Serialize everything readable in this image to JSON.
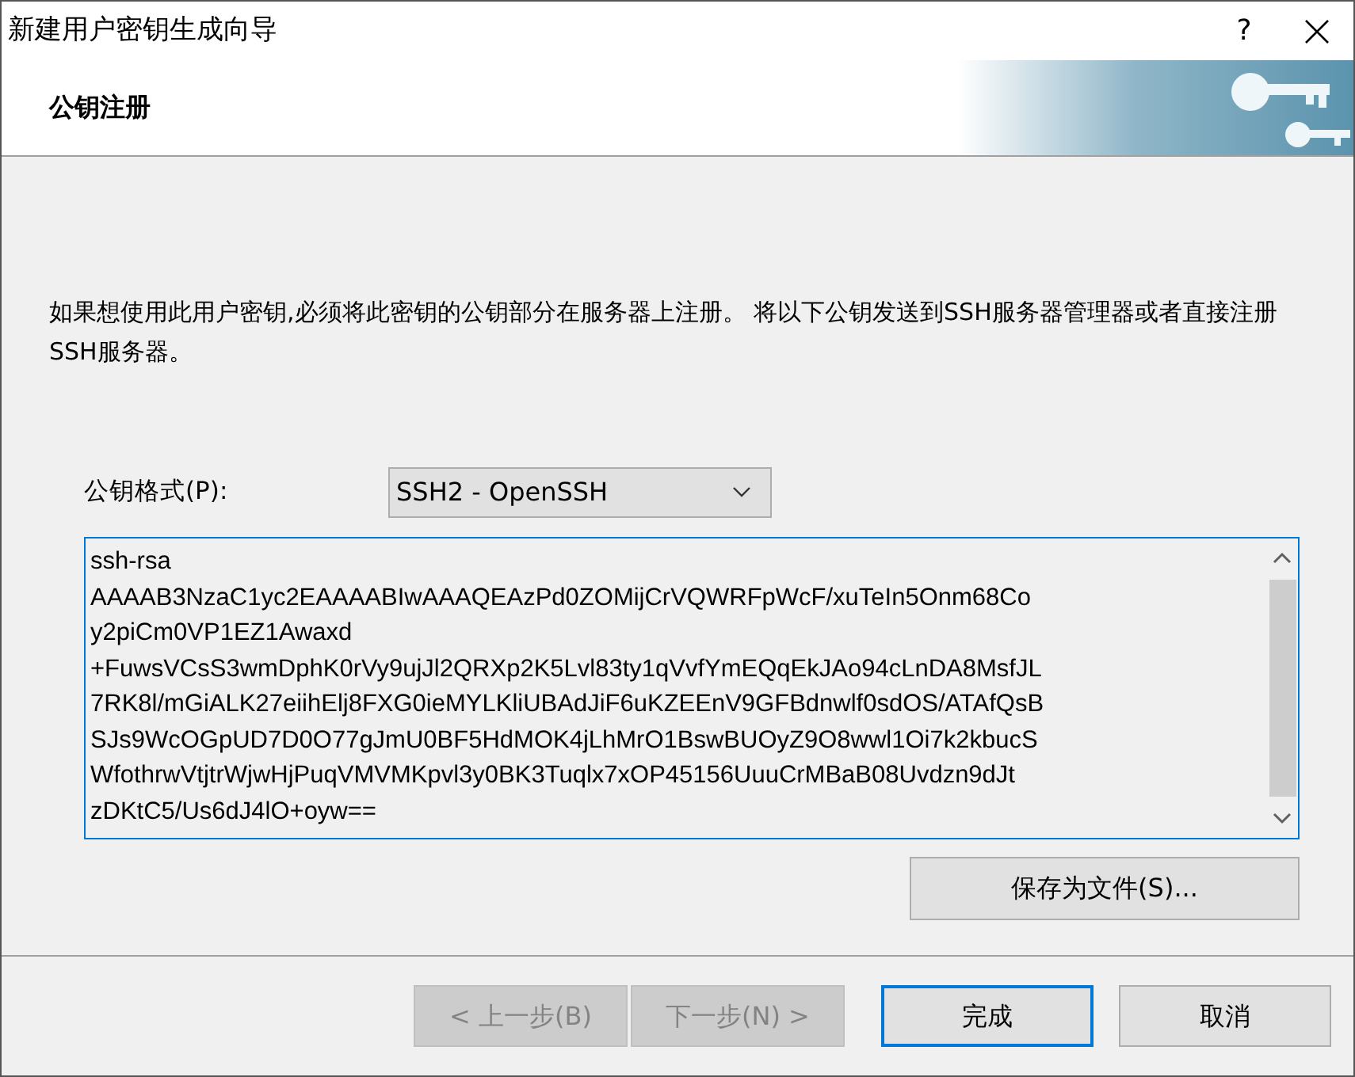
{
  "window": {
    "title": "新建用户密钥生成向导",
    "help_button": "?"
  },
  "header": {
    "title": "公钥注册"
  },
  "description": "如果想使用此用户密钥,必须将此密钥的公钥部分在服务器上注册。 将以下公钥发送到SSH服务器管理器或者直接注册SSH服务器。",
  "format": {
    "label": "公钥格式(P):",
    "value": "SSH2 - OpenSSH"
  },
  "public_key_lines": [
    "ssh-rsa",
    "AAAAB3NzaC1yc2EAAAABIwAAAQEAzPd0ZOMijCrVQWRFpWcF/xuTeIn5Onm68Co",
    "y2piCm0VP1EZ1Awaxd",
    "+FuwsVCsS3wmDphK0rVy9ujJl2QRXp2K5Lvl83ty1qVvfYmEQqEkJAo94cLnDA8MsfJL",
    "7RK8l/mGiALK27eiihElj8FXG0ieMYLKliUBAdJiF6uKZEEnV9GFBdnwlf0sdOS/ATAfQsB",
    "SJs9WcOGpUD7D0O77gJmU0BF5HdMOK4jLhMrO1BswBUOyZ9O8wwl1Oi7k2kbucS",
    "WfothrwVtjtrWjwHjPuqVMVMKpvl3y0BK3Tuqlx7xOP45156UuuCrMBaB08Uvdzn9dJt",
    "zDKtC5/Us6dJ4lO+oyw=="
  ],
  "save_button": "保存为文件(S)...",
  "buttons": [
    {
      "label": "< 上一步(B)",
      "disabled": true,
      "default": false
    },
    {
      "label": "下一步(N) >",
      "disabled": true,
      "default": false
    },
    {
      "label": "完成",
      "disabled": false,
      "default": true
    },
    {
      "label": "取消",
      "disabled": false,
      "default": false
    }
  ]
}
